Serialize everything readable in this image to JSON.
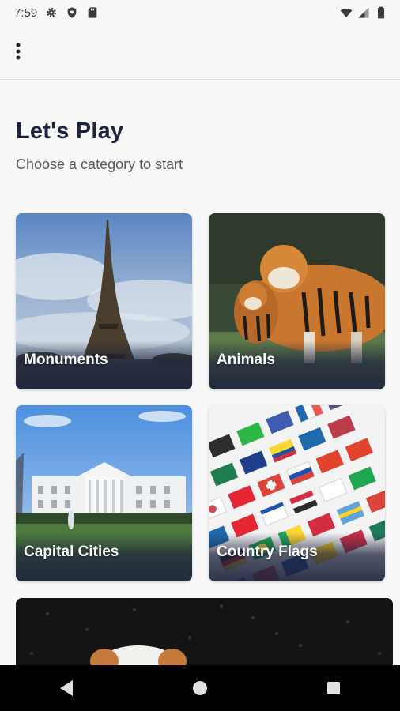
{
  "status_bar": {
    "time": "7:59",
    "left_icons": [
      "settings-icon",
      "shield-icon",
      "sd-card-icon"
    ],
    "right_icons": [
      "wifi-icon",
      "signal-icon",
      "battery-icon"
    ]
  },
  "app_bar": {
    "overflow_icon": "more-vert-icon"
  },
  "header": {
    "title": "Let's Play",
    "subtitle": "Choose a category to start"
  },
  "categories": [
    {
      "label": "Monuments"
    },
    {
      "label": "Animals"
    },
    {
      "label": "Capital Cities"
    },
    {
      "label": "Country Flags"
    }
  ],
  "nav_bar": {
    "buttons": [
      "back-icon",
      "home-icon",
      "recents-icon"
    ]
  },
  "colors": {
    "title": "#1e2340",
    "label_shade": "#1e233c",
    "background": "#f8f8f8"
  }
}
